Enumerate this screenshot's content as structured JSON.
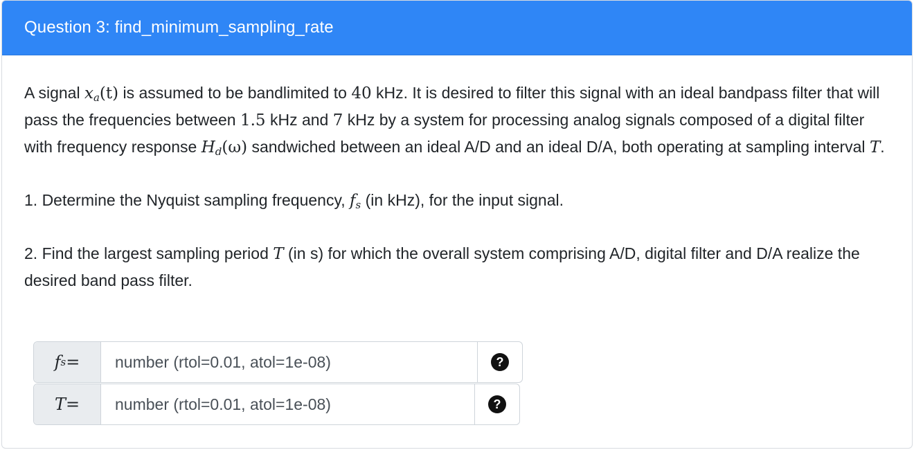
{
  "header": {
    "title": "Question 3: find_minimum_sampling_rate"
  },
  "body": {
    "p1": {
      "t1": "A signal ",
      "x": "x",
      "a": "a",
      "t": "(t)",
      "t2": " is assumed to be bandlimited to ",
      "n40": "40",
      "t3": " kHz. It is desired to filter this signal with an ideal bandpass filter that will pass the frequencies between ",
      "n15": "1.5",
      "t4": " kHz and ",
      "n7": "7",
      "t5": " kHz by a system for processing analog signals composed of a digital filter with frequency response ",
      "H": "H",
      "d": "d",
      "w": "(ω)",
      "t6": " sandwiched between an ideal A/D and an ideal D/A, both operating at sampling interval ",
      "T": "T",
      "t7": "."
    },
    "p2": {
      "t1": "1. Determine the Nyquist sampling frequency, ",
      "f": "f",
      "s": "s",
      "t2": " (in kHz), for the input signal."
    },
    "p3": {
      "t1": "2. Find the largest sampling period ",
      "T": "T",
      "t2": " (in s) for which the overall system comprising A/D, digital filter and D/A realize the desired band pass filter."
    }
  },
  "inputs": [
    {
      "label_var": "f",
      "label_sub": "s",
      "eq": " =",
      "placeholder": "number (rtol=0.01, atol=1e-08)",
      "help_icon": "question-circle-icon",
      "help_glyph": "?"
    },
    {
      "label_var": "T",
      "label_sub": "",
      "eq": " =",
      "placeholder": "number (rtol=0.01, atol=1e-08)",
      "help_icon": "question-circle-icon",
      "help_glyph": "?"
    }
  ],
  "colors": {
    "header_bg": "#2f86f6",
    "header_text": "#ffffff",
    "addon_bg": "#e9ecef"
  }
}
